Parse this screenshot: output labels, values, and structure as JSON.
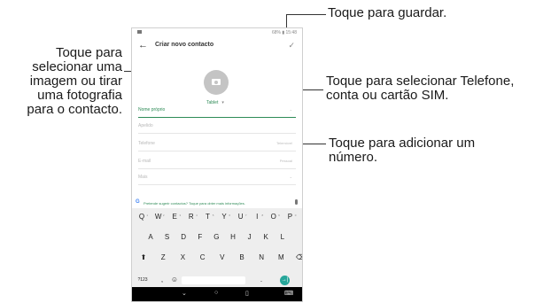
{
  "callouts": {
    "save": "Toque para guardar.",
    "image": [
      "Toque para",
      "selecionar uma",
      "imagem ou tirar",
      "uma fotografia",
      "para o contacto."
    ],
    "account": [
      "Toque para selecionar Telefone,",
      "conta ou cartão SIM."
    ],
    "number": [
      "Toque para adicionar um",
      "número."
    ]
  },
  "screen": {
    "status": "68% ▮ 15:48",
    "title": "Criar novo contacto",
    "back_icon": "arrow-left-icon",
    "check_icon": "check-icon",
    "account": "Tablet",
    "fields": {
      "first_name": "Nome próprio",
      "last_name": "Apelido",
      "phone": "Telefone",
      "phone_type": "Telemóvel",
      "email": "E-mail",
      "email_type": "Pessoal",
      "more": "Mais"
    },
    "suggestion": "Pretende sugerir contactos? Toque para obter mais informações.",
    "keyboard": {
      "row1": [
        "Q",
        "W",
        "E",
        "R",
        "T",
        "Y",
        "U",
        "I",
        "O",
        "P"
      ],
      "row1_sup": [
        "1",
        "2",
        "3",
        "4",
        "5",
        "6",
        "7",
        "8",
        "9",
        "0"
      ],
      "row2": [
        "A",
        "S",
        "D",
        "F",
        "G",
        "H",
        "J",
        "K",
        "L"
      ],
      "row3": [
        "⬆",
        "Z",
        "X",
        "C",
        "V",
        "B",
        "N",
        "M",
        "⌫"
      ],
      "sym": "?123",
      "comma": ",",
      "emoji": "☺",
      "period": ".",
      "enter": "→|"
    },
    "nav": {
      "back": "⌄",
      "home": "○",
      "recents": "▯",
      "keyboard": "⌨"
    }
  }
}
